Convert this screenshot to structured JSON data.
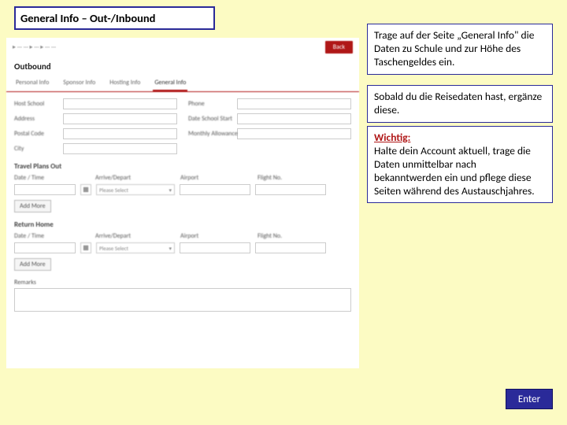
{
  "title": "General Info – Out-/Inbound",
  "shot": {
    "breadcrumb": "▸ ··· ··· ▸ ··· ▸ ··· ···",
    "back": "Back",
    "outbound": "Outbound",
    "tabs": {
      "t1": "Personal Info",
      "t2": "Sponsor Info",
      "t3": "Hosting Info",
      "t4": "General Info"
    },
    "labels": {
      "host_school": "Host School",
      "phone": "Phone",
      "address": "Address",
      "date_school_start": "Date School Start",
      "postal_code": "Postal Code",
      "monthly_allowance": "Monthly Allowance",
      "city": "City"
    },
    "section_out": "Travel Plans Out",
    "section_return": "Return Home",
    "cols": {
      "c1": "Date / Time",
      "c2": "Arrive/Depart",
      "c3": "Airport",
      "c4": "Flight No."
    },
    "please_select": "Please Select",
    "add_more": "Add More",
    "remarks": "Remarks"
  },
  "boxes": {
    "b1": "Trage auf der Seite „General Info\" die Daten zu Schule und zur Höhe des Taschengeldes ein.",
    "b2": "Sobald du die Reisedaten hast, ergänze diese.",
    "b3_wichtig": "Wichtig:",
    "b3_body": "Halte dein Account aktuell, trage die Daten unmittelbar nach bekanntwerden ein und pflege diese Seiten während des Austauschjahres."
  },
  "enter": "Enter"
}
